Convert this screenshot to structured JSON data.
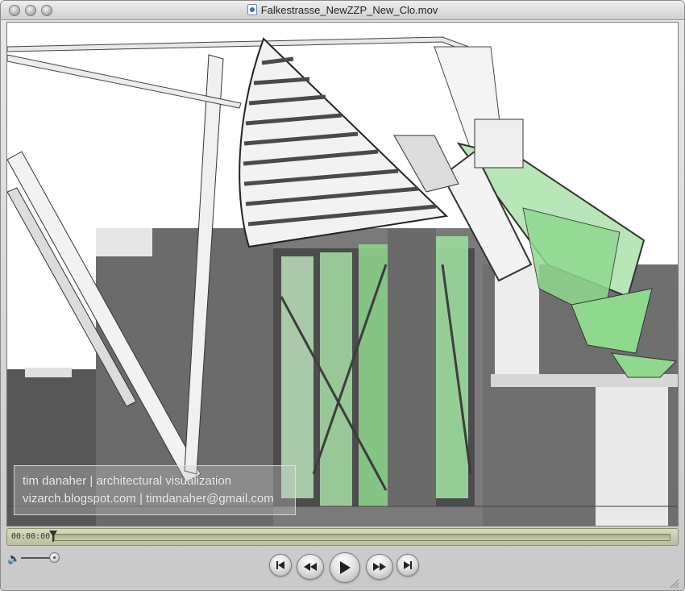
{
  "window": {
    "title": "Falkestrasse_NewZZP_New_Clo.mov"
  },
  "video": {
    "watermark_line1": "tim danaher | architectural visualization",
    "watermark_line2": "vizarch.blogspot.com | timdanaher@gmail.com"
  },
  "player": {
    "time": "00:00:00",
    "progress": 0,
    "volume": 1.0
  },
  "icons": {
    "close": "close-icon",
    "minimize": "minimize-icon",
    "zoom": "zoom-icon",
    "file": "movie-file-icon",
    "volume": "speaker-icon",
    "start": "skip-to-start-icon",
    "rewind": "rewind-icon",
    "play": "play-icon",
    "forward": "fast-forward-icon",
    "end": "skip-to-end-icon"
  },
  "colors": {
    "glass_green": "#8fd98f",
    "wall_gray": "#6e6e6e",
    "scrubber": "#c9ceaa"
  }
}
